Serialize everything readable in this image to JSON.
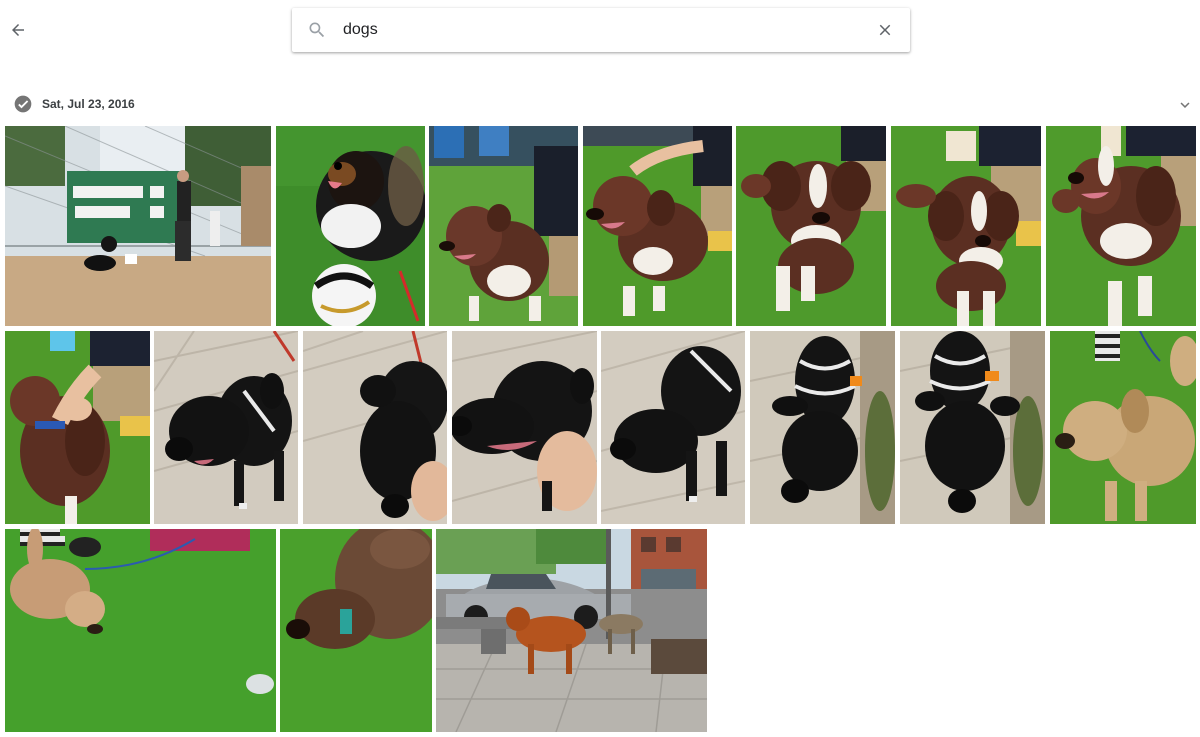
{
  "header": {
    "back_icon": "arrow-back-icon",
    "search": {
      "value": "dogs",
      "icon": "search-icon",
      "clear_icon": "close-icon"
    }
  },
  "section": {
    "date": "Sat, Jul 23, 2016",
    "select_icon": "check-circle-icon",
    "collapse_icon": "chevron-down-icon"
  },
  "colors": {
    "grass": "#4f9a2a",
    "sand": "#c9b08f",
    "sidewalk": "#cfc8bd",
    "chocolate_dog": "#5a2f22",
    "black_dog": "#141414",
    "tan_dog": "#c9a777",
    "icon_gray": "#757575"
  }
}
